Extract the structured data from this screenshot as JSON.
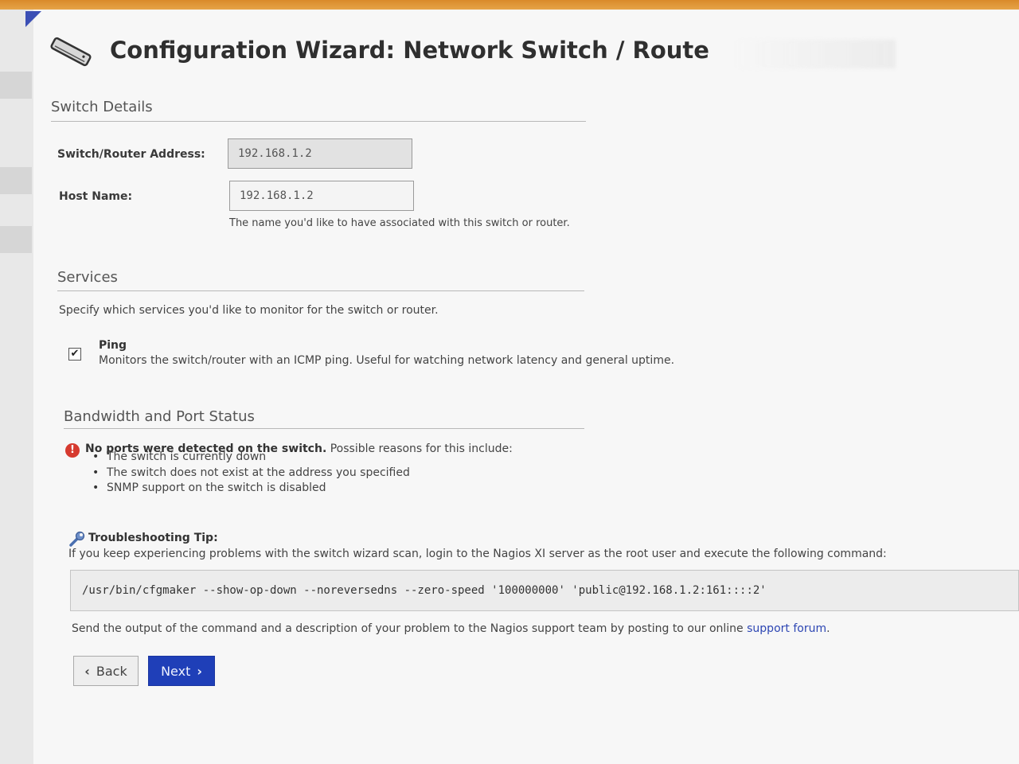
{
  "page": {
    "title": "Configuration Wizard: Network Switch / Route"
  },
  "switch_details": {
    "heading": "Switch Details",
    "address_label": "Switch/Router Address:",
    "address_value": "192.168.1.2",
    "hostname_label": "Host Name:",
    "hostname_value": "192.168.1.2",
    "hostname_hint": "The name you'd like to have associated with this switch or router."
  },
  "services": {
    "heading": "Services",
    "description": "Specify which services you'd like to monitor for the switch or router.",
    "ping": {
      "checked": true,
      "checkmark": "✔",
      "label": "Ping",
      "description": "Monitors the switch/router with an ICMP ping. Useful for watching network latency and general uptime."
    }
  },
  "bandwidth": {
    "heading": "Bandwidth and Port Status",
    "error_icon": "!",
    "error_bold": "No ports were detected on the switch.",
    "error_rest": " Possible reasons for this include:",
    "reasons": [
      "The switch is currently down",
      "The switch does not exist at the address you specified",
      "SNMP support on the switch is disabled"
    ],
    "tip_title": "Troubleshooting Tip:",
    "tip_text": "If you keep experiencing problems with the switch wizard scan, login to the Nagios XI server as the root user and execute the following command:",
    "command": "/usr/bin/cfgmaker --show-op-down --noreversedns --zero-speed '100000000' 'public@192.168.1.2:161::::2'",
    "send_text": "Send the output of the command and a description of your problem to the Nagios support team by posting to our online ",
    "support_link": "support forum",
    "send_end": "."
  },
  "buttons": {
    "back_label": "Back",
    "next_label": "Next"
  },
  "colors": {
    "accent": "#1f3fb8",
    "error": "#d63a2f",
    "top_strip": "#d98a2a"
  }
}
